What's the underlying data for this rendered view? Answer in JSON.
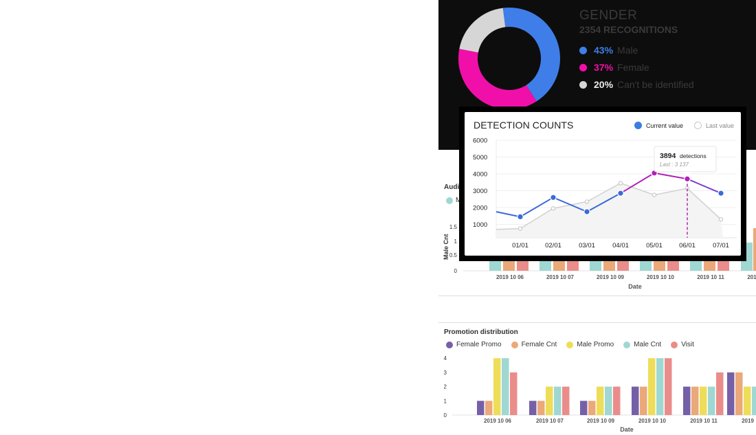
{
  "colors": {
    "male": "#3f7ee8",
    "female": "#f10fa9",
    "unknown": "#d6d6d6",
    "current": "#3a6bd8",
    "current_high": "#b21fb8",
    "last": "#cfcfcf",
    "female_promo": "#7560a8",
    "female_cnt": "#eba878",
    "male_promo": "#eedd58",
    "male_cnt": "#9fd8d3",
    "visit": "#ea8d8a"
  },
  "gender": {
    "title": "GENDER",
    "subtitle": "2354 RECOGNITIONS",
    "legend": [
      {
        "pct": "43%",
        "label": "Male",
        "color": "#3f7ee8"
      },
      {
        "pct": "37%",
        "label": "Female",
        "color": "#f10fa9"
      },
      {
        "pct": "20%",
        "label": "Can't be identified",
        "color": "#d6d6d6"
      }
    ]
  },
  "audience": {
    "title_fragment": "Audi",
    "legend_fragment": "M",
    "y_axis_label": "Male Cnt",
    "y_ticks_visible": [
      "0",
      "0.5"
    ],
    "x_axis_label": "Date",
    "dates": [
      "2019 10 06",
      "2019 10 07",
      "2019 10 09",
      "2019 10 10",
      "2019 10 11",
      "201"
    ]
  },
  "detection": {
    "title": "DETECTION COUNTS",
    "legend_current": "Current value",
    "legend_last": "Last value",
    "tooltip_value": "3894",
    "tooltip_unit": "detections",
    "tooltip_last": "Last : 3 137",
    "y_ticks": [
      "6000",
      "5000",
      "4000",
      "3000",
      "2000",
      "1000"
    ],
    "x_ticks": [
      "01/01",
      "02/01",
      "03/01",
      "04/01",
      "05/01",
      "06/01",
      "07/01"
    ]
  },
  "promotion": {
    "title": "Promotion distribution",
    "legend": [
      {
        "label": "Female Promo",
        "color": "#7560a8"
      },
      {
        "label": "Female Cnt",
        "color": "#eba878"
      },
      {
        "label": "Male Promo",
        "color": "#eedd58"
      },
      {
        "label": "Male Cnt",
        "color": "#9fd8d3"
      },
      {
        "label": "Visit",
        "color": "#ea8d8a"
      }
    ],
    "y_ticks": [
      "4",
      "3",
      "2",
      "1",
      "0"
    ],
    "x_axis_label": "Date",
    "dates": [
      "2019 10 06",
      "2019 10 07",
      "2019 10 09",
      "2019 10 10",
      "2019 10 11",
      "2019"
    ]
  },
  "chart_data": [
    {
      "type": "pie",
      "title": "GENDER",
      "subtitle": "2354 RECOGNITIONS",
      "categories": [
        "Male",
        "Female",
        "Can't be identified"
      ],
      "values": [
        43,
        37,
        20
      ]
    },
    {
      "type": "line",
      "title": "DETECTION COUNTS",
      "categories": [
        "01/01",
        "02/01",
        "03/01",
        "04/01",
        "05/01",
        "06/01",
        "07/01"
      ],
      "x_first_partial": 1750,
      "series": [
        {
          "name": "Current value",
          "values": [
            1450,
            2600,
            1750,
            2850,
            4050,
            3700,
            2850
          ]
        },
        {
          "name": "Last value",
          "values": [
            750,
            1950,
            2350,
            3450,
            2750,
            3137,
            1300
          ]
        }
      ],
      "ylim": [
        500,
        6000
      ],
      "highlight": {
        "category": "06/01",
        "value": 3894,
        "last": 3137
      }
    },
    {
      "type": "bar",
      "title": "Promotion distribution",
      "xlabel": "Date",
      "categories": [
        "2019 10 06",
        "2019 10 07",
        "2019 10 09",
        "2019 10 10",
        "2019 10 11",
        "2019"
      ],
      "series": [
        {
          "name": "Female Promo",
          "values": [
            1,
            1,
            1,
            2,
            2,
            3
          ]
        },
        {
          "name": "Female Cnt",
          "values": [
            1,
            1,
            1,
            2,
            2,
            3
          ]
        },
        {
          "name": "Male Promo",
          "values": [
            4,
            2,
            2,
            4,
            2,
            2
          ]
        },
        {
          "name": "Male Cnt",
          "values": [
            4,
            2,
            2,
            4,
            2,
            2
          ]
        },
        {
          "name": "Visit",
          "values": [
            3,
            2,
            2,
            4,
            3,
            2
          ]
        }
      ],
      "ylim": [
        0,
        4
      ]
    },
    {
      "type": "bar",
      "title": "Audi",
      "ylabel": "Male Cnt",
      "xlabel": "Date",
      "categories": [
        "2019 10 06",
        "2019 10 07",
        "2019 10 09",
        "2019 10 10",
        "2019 10 11",
        "201"
      ],
      "series": [
        {
          "name": "M",
          "values": [
            0.2,
            0.2,
            0.2,
            0.2,
            0.2,
            1
          ]
        }
      ]
    }
  ]
}
